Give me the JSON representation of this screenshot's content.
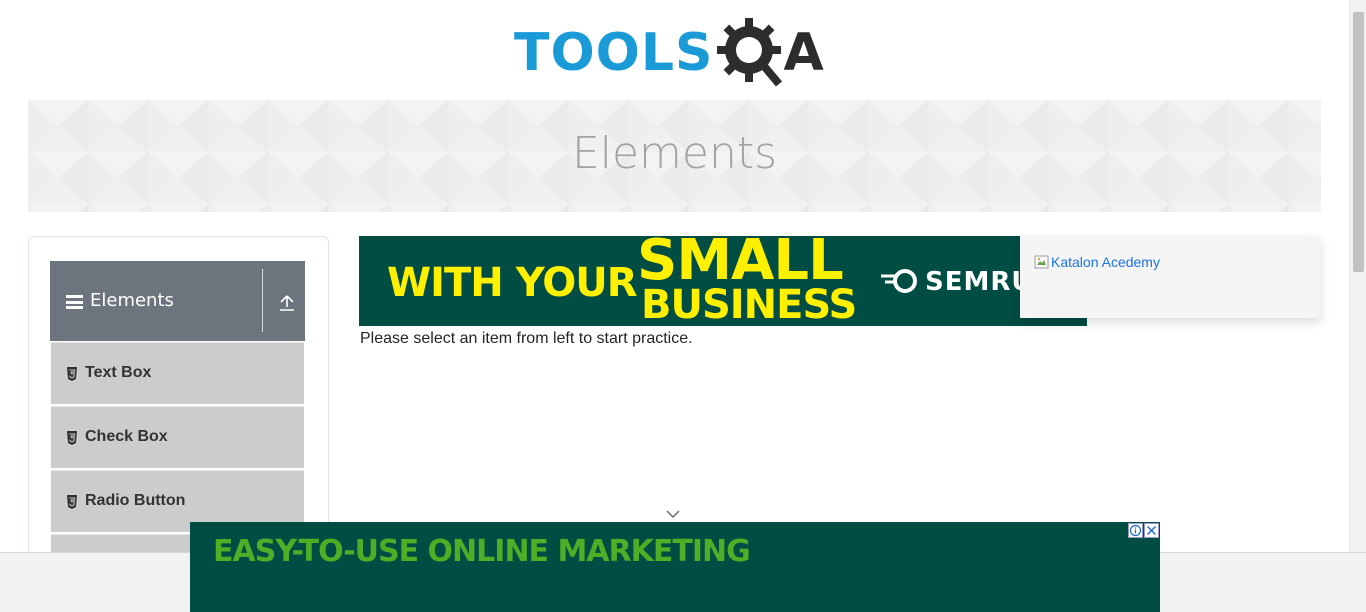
{
  "logo": {
    "part1": "TOOLS",
    "part2": "A"
  },
  "banner": {
    "title": "Elements"
  },
  "sidebar": {
    "group": {
      "title": "Elements"
    },
    "items": [
      {
        "label": "Text Box"
      },
      {
        "label": "Check Box"
      },
      {
        "label": "Radio Button"
      }
    ]
  },
  "ad_top": {
    "line1": "WITH YOUR",
    "line2": "SMALL",
    "line3": "BUSINESS",
    "brand": "SEMRU"
  },
  "katalon": {
    "alt": "Katalon Acedemy"
  },
  "main": {
    "instructions": "Please select an item from left to start practice."
  },
  "ad_bottom": {
    "headline": "EASY-TO-USE ONLINE MARKETING",
    "choices": "i",
    "close": "✕"
  },
  "colors": {
    "brand_blue": "#1a9bd7",
    "header_gray": "#6c757d",
    "ad_green": "#004d43",
    "ad_yellow": "#ffef00"
  }
}
